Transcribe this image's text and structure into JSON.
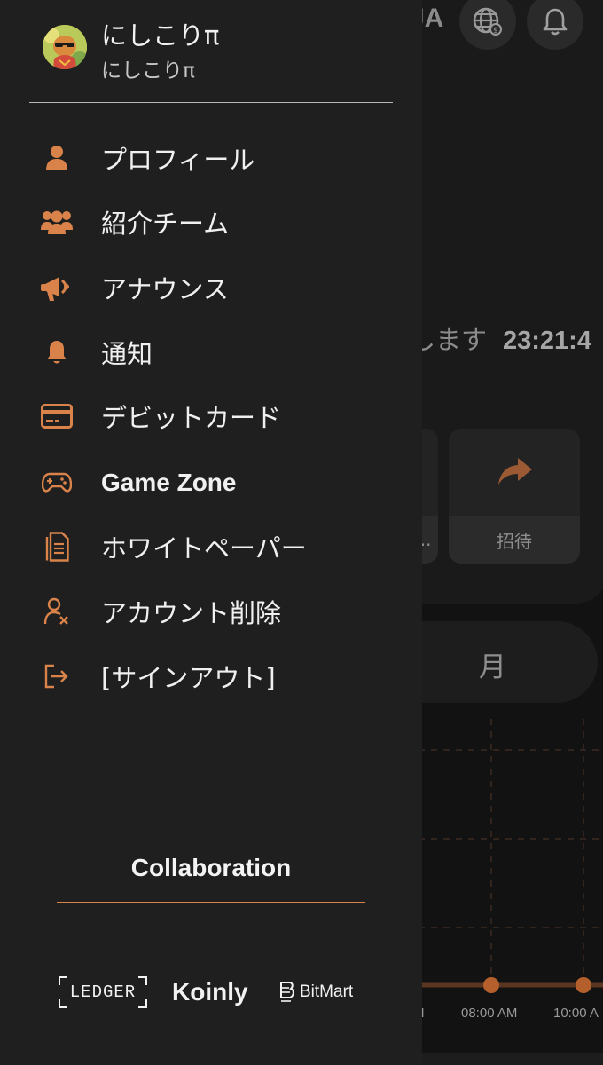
{
  "background": {
    "header_text": "JA",
    "timer_text": "します",
    "timer_value": "23:21:4",
    "tile_partial_label": "...",
    "tile_invite_label": "招待",
    "pill_label": "月",
    "time_ticks": [
      "M",
      "08:00 AM",
      "10:00 A"
    ]
  },
  "user": {
    "name": "にしこりπ",
    "username": "にしこりπ"
  },
  "menu": [
    {
      "label": "プロフィール",
      "icon": "user-icon"
    },
    {
      "label": "紹介チーム",
      "icon": "users-icon"
    },
    {
      "label": "アナウンス",
      "icon": "megaphone-icon"
    },
    {
      "label": "通知",
      "icon": "bell-icon"
    },
    {
      "label": "デビットカード",
      "icon": "credit-card-icon"
    },
    {
      "label": "Game Zone",
      "icon": "gamepad-icon"
    },
    {
      "label": "ホワイトペーパー",
      "icon": "document-icon"
    },
    {
      "label": "アカウント削除",
      "icon": "user-remove-icon"
    },
    {
      "label": "[サインアウト]",
      "icon": "sign-out-icon"
    }
  ],
  "collaboration": {
    "title": "Collaboration",
    "partners": [
      "LEDGER",
      "Koinly",
      "BitMart"
    ]
  },
  "colors": {
    "accent": "#D9834A",
    "drawer_bg": "#1F1F1F",
    "page_bg": "#121212"
  }
}
